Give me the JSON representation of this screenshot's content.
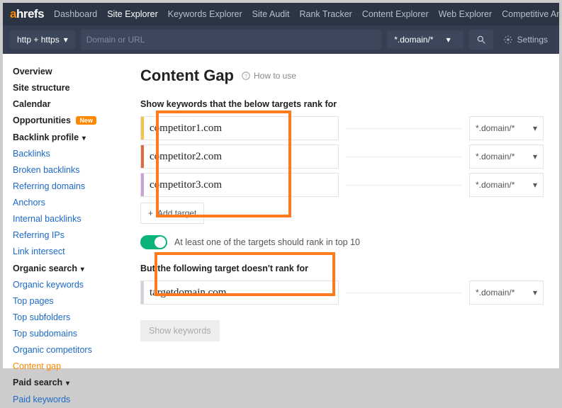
{
  "brand": {
    "a": "a",
    "rest": "hrefs"
  },
  "nav": [
    "Dashboard",
    "Site Explorer",
    "Keywords Explorer",
    "Site Audit",
    "Rank Tracker",
    "Content Explorer",
    "Web Explorer",
    "Competitive Anal"
  ],
  "nav_active_index": 1,
  "subbar": {
    "protocol": "http + https",
    "url_placeholder": "Domain or URL",
    "url_value": "",
    "mode": "*.domain/*",
    "settings": "Settings"
  },
  "sidebar": {
    "overview": "Overview",
    "structure": "Site structure",
    "calendar": "Calendar",
    "opportunities": "Opportunities",
    "new_badge": "New",
    "backlink_profile": "Backlink profile",
    "backlinks": "Backlinks",
    "broken_backlinks": "Broken backlinks",
    "referring_domains": "Referring domains",
    "anchors": "Anchors",
    "internal_backlinks": "Internal backlinks",
    "referring_ips": "Referring IPs",
    "link_intersect": "Link intersect",
    "organic_search": "Organic search",
    "organic_keywords": "Organic keywords",
    "top_pages": "Top pages",
    "top_subfolders": "Top subfolders",
    "top_subdomains": "Top subdomains",
    "organic_competitors": "Organic competitors",
    "content_gap": "Content gap",
    "paid_search": "Paid search",
    "paid_keywords": "Paid keywords"
  },
  "page": {
    "title": "Content Gap",
    "howto": "How to use",
    "section1": "Show keywords that the below targets rank for",
    "targets": [
      {
        "value": "competitor1.com",
        "scope": "*.domain/*",
        "color": "#f5c242"
      },
      {
        "value": "competitor2.com",
        "scope": "*.domain/*",
        "color": "#e06a3b"
      },
      {
        "value": "competitor3.com",
        "scope": "*.domain/*",
        "color": "#c9a3d4"
      }
    ],
    "add_target": "Add target",
    "toggle_label": "At least one of the targets should rank in top 10",
    "toggle_on": true,
    "section2": "But the following target doesn't rank for",
    "own_target": {
      "value": "targetdomain.com",
      "scope": "*.domain/*",
      "color": "#cfd4da"
    },
    "show_keywords": "Show keywords"
  }
}
